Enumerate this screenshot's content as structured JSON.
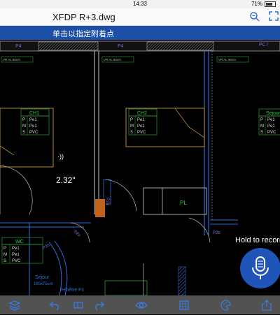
{
  "status": {
    "time": "14:33",
    "battery": "71%"
  },
  "header": {
    "title": "XFDP R+3.dwg"
  },
  "hint": {
    "text": "单击以指定附着点"
  },
  "drawing": {
    "measurement": "2.32\"",
    "room_labels": [
      "CH1",
      "CH2",
      "Séjour",
      "WC",
      "PL",
      "Séjour"
    ],
    "tag_rows": [
      "P Pe1",
      "M Pe1",
      "S PVC"
    ],
    "door_labels": [
      "P4",
      "P4",
      "PC7",
      "P2a",
      "P2a",
      "P2b",
      "P2b"
    ],
    "misc": [
      "VR AL 60cm",
      "165x75cm",
      "Fenêtre F1"
    ]
  },
  "voice": {
    "hold_label": "Hold to record"
  },
  "toolbar": {
    "icons": [
      "layers-icon",
      "undo-icon",
      "eraser-icon",
      "redo-icon",
      "eye-icon",
      "grid-icon",
      "palette-icon",
      "share-icon"
    ]
  }
}
